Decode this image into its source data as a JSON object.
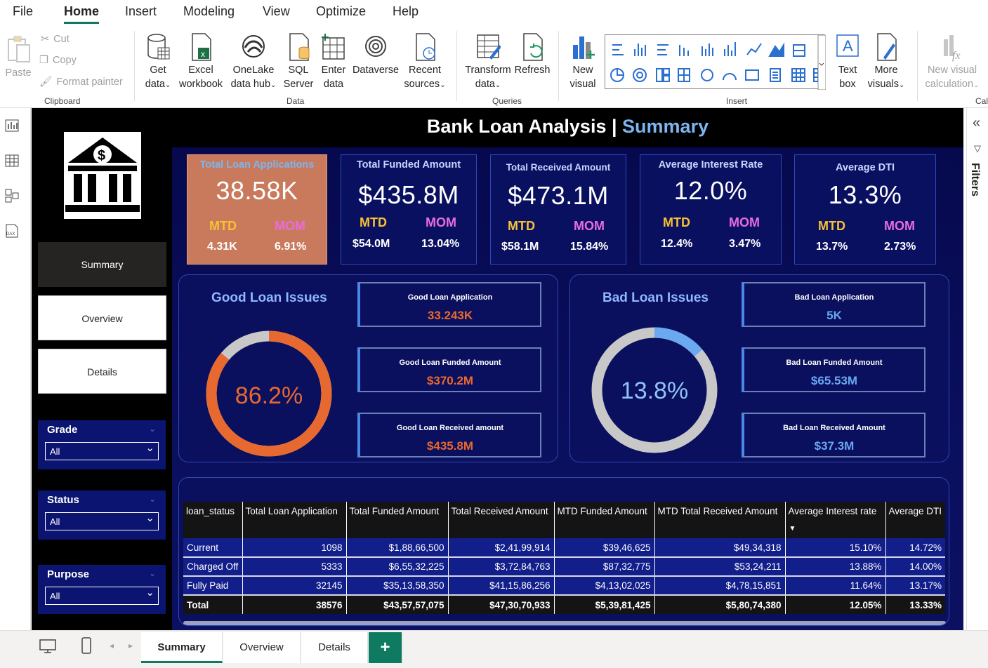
{
  "menu": [
    "File",
    "Home",
    "Insert",
    "Modeling",
    "View",
    "Optimize",
    "Help"
  ],
  "ribbon": {
    "clipboard": {
      "paste": "Paste",
      "cut": "Cut",
      "copy": "Copy",
      "format_painter": "Format painter",
      "label": "Clipboard"
    },
    "data": {
      "get_data": [
        "Get",
        "data"
      ],
      "excel": [
        "Excel",
        "workbook"
      ],
      "onelake": [
        "OneLake",
        "data hub"
      ],
      "sql": [
        "SQL",
        "Server"
      ],
      "enter": [
        "Enter",
        "data"
      ],
      "dataverse": "Dataverse",
      "recent": [
        "Recent",
        "sources"
      ],
      "label": "Data"
    },
    "queries": {
      "transform": [
        "Transform",
        "data"
      ],
      "refresh": "Refresh",
      "label": "Queries"
    },
    "insert": {
      "new_visual": [
        "New",
        "visual"
      ],
      "text_box": [
        "Text",
        "box"
      ],
      "more_visuals": [
        "More",
        "visuals"
      ],
      "label": "Insert"
    },
    "calc": {
      "new_calc": [
        "New visual",
        "calculation"
      ],
      "label": "Cal"
    }
  },
  "report": {
    "title_main": "Bank Loan Analysis | ",
    "title_hl": "Summary",
    "nav": {
      "summary": "Summary",
      "overview": "Overview",
      "details": "Details"
    },
    "slicers": [
      {
        "title": "Grade",
        "value": "All"
      },
      {
        "title": "Status",
        "value": "All"
      },
      {
        "title": "Purpose",
        "value": "All"
      }
    ],
    "kpis": [
      {
        "title": "Total Loan Applications",
        "value": "38.58K",
        "mtd_label": "MTD",
        "mom_label": "MOM",
        "mtd": "4.31K",
        "mom": "6.91%"
      },
      {
        "title": "Total Funded Amount",
        "value": "$435.8M",
        "mtd_label": "MTD",
        "mom_label": "MOM",
        "mtd": "$54.0M",
        "mom": "13.04%"
      },
      {
        "title": "Total Received Amount",
        "value": "$473.1M",
        "mtd_label": "MTD",
        "mom_label": "MOM",
        "mtd": "$58.1M",
        "mom": "15.84%"
      },
      {
        "title": "Average Interest Rate",
        "value": "12.0%",
        "mtd_label": "MTD",
        "mom_label": "MOM",
        "mtd": "12.4%",
        "mom": "3.47%"
      },
      {
        "title": "Average DTI",
        "value": "13.3%",
        "mtd_label": "MTD",
        "mom_label": "MOM",
        "mtd": "13.7%",
        "mom": "2.73%"
      }
    ],
    "good": {
      "title": "Good Loan Issues",
      "percent_label": "86.2%",
      "percent": 86.2,
      "cards": [
        {
          "title": "Good Loan Application",
          "value": "33.243K"
        },
        {
          "title": "Good Loan Funded Amount",
          "value": "$370.2M"
        },
        {
          "title": "Good Loan Received amount",
          "value": "$435.8M"
        }
      ]
    },
    "bad": {
      "title": "Bad Loan Issues",
      "percent_label": "13.8%",
      "percent": 13.8,
      "cards": [
        {
          "title": "Bad Loan Application",
          "value": "5K"
        },
        {
          "title": "Bad Loan Funded Amount",
          "value": "$65.53M"
        },
        {
          "title": "Bad Loan Received Amount",
          "value": "$37.3M"
        }
      ]
    },
    "table": {
      "headers": [
        "loan_status",
        "Total Loan Application",
        "Total Funded Amount",
        "Total Received Amount",
        "MTD Funded Amount",
        "MTD Total Received Amount",
        "Average Interest rate",
        "Average DTI"
      ],
      "rows": [
        [
          "Current",
          "1098",
          "$1,88,66,500",
          "$2,41,99,914",
          "$39,46,625",
          "$49,34,318",
          "15.10%",
          "14.72%"
        ],
        [
          "Charged Off",
          "5333",
          "$6,55,32,225",
          "$3,72,84,763",
          "$87,32,775",
          "$53,24,211",
          "13.88%",
          "14.00%"
        ],
        [
          "Fully Paid",
          "32145",
          "$35,13,58,350",
          "$41,15,86,256",
          "$4,13,02,025",
          "$4,78,15,851",
          "11.64%",
          "13.17%"
        ],
        [
          "Total",
          "38576",
          "$43,57,57,075",
          "$47,30,70,933",
          "$5,39,81,425",
          "$5,80,74,380",
          "12.05%",
          "13.33%"
        ]
      ]
    }
  },
  "right_pane": {
    "filters": "Filters"
  },
  "pages": {
    "tabs": [
      "Summary",
      "Overview",
      "Details"
    ],
    "add": "+"
  },
  "colors": {
    "accent": "#0e7a5f",
    "kpi_highlight": "#c97a5c",
    "good_ring": "#e8692f",
    "bad_ring": "#6aa8f0",
    "ring_track": "#c8c8c8",
    "mtd": "#f7c233",
    "mom": "#e86ce0"
  }
}
